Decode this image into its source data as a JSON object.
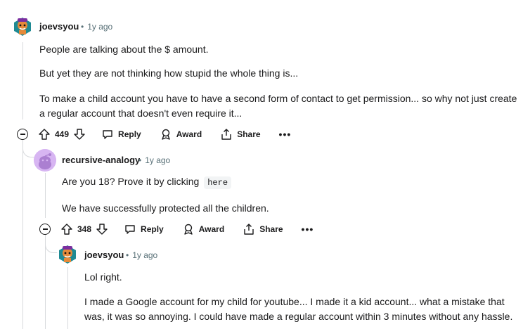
{
  "comments": [
    {
      "author": "joevsyou",
      "age": "1y ago",
      "paragraphs": [
        "People are talking about the $ amount.",
        "But yet they are not thinking how stupid the whole thing is...",
        "To make a child account you have to have a second form of contact to get permission... so why not just create",
        "a regular account that doesn't even require it..."
      ],
      "score": "449",
      "reply_label": "Reply",
      "award_label": "Award",
      "share_label": "Share",
      "more_label": "•••"
    },
    {
      "author": "recursive-analogy",
      "age": "1y ago",
      "line1_text": "Are you 18? Prove it by clicking",
      "line1_code": "here",
      "line2": "We have successfully protected all the children.",
      "score": "348",
      "reply_label": "Reply",
      "award_label": "Award",
      "share_label": "Share",
      "more_label": "•••"
    },
    {
      "author": "joevsyou",
      "age": "1y ago",
      "paragraphs": [
        "Lol right.",
        "I made a Google account for my child for youtube... I made it a kid account... what a mistake that",
        "was, it was so annoying. I could have made a regular account within 3 minutes without any hassle."
      ]
    }
  ],
  "separator": "•",
  "colors": {
    "text": "#1a1a1b",
    "meta": "#576f76",
    "thread_line": "#d7d9dc",
    "avatar_purple": "#d7b5f2",
    "avatar_teal": "#1f8a93"
  }
}
